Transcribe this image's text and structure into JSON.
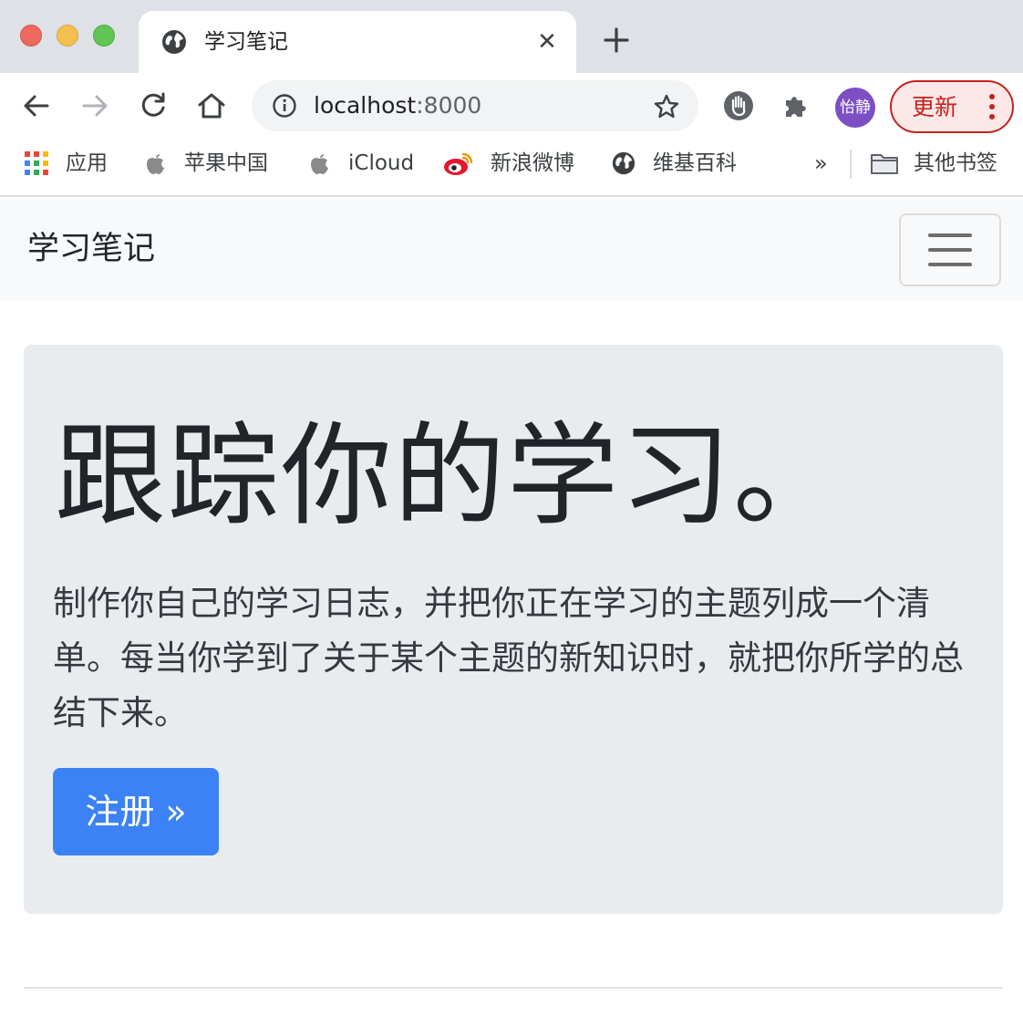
{
  "browser": {
    "tab": {
      "title": "学习笔记",
      "close_glyph": "✕"
    },
    "address_bar": {
      "host": "localhost",
      "port": ":8000"
    },
    "profile": {
      "initials": "怡静",
      "color": "#7c4fc3"
    },
    "update_button": {
      "label": "更新",
      "color": "#c5221f"
    }
  },
  "bookmarks": {
    "items": [
      {
        "label": "应用",
        "icon": "apps-grid-icon"
      },
      {
        "label": "苹果中国",
        "icon": "apple-icon"
      },
      {
        "label": "iCloud",
        "icon": "apple-icon"
      },
      {
        "label": "新浪微博",
        "icon": "weibo-icon"
      },
      {
        "label": "维基百科",
        "icon": "globe-icon"
      }
    ],
    "overflow": "»",
    "other": {
      "label": "其他书签",
      "icon": "folder-icon"
    }
  },
  "navbar": {
    "brand": "学习笔记"
  },
  "hero": {
    "title": "跟踪你的学习。",
    "lead": "制作你自己的学习日志，并把你正在学习的主题列成一个清单。每当你学到了关于某个主题的新知识时，就把你所学的总结下来。",
    "button_label": "注册 »",
    "button_color": "#3b82f6"
  }
}
